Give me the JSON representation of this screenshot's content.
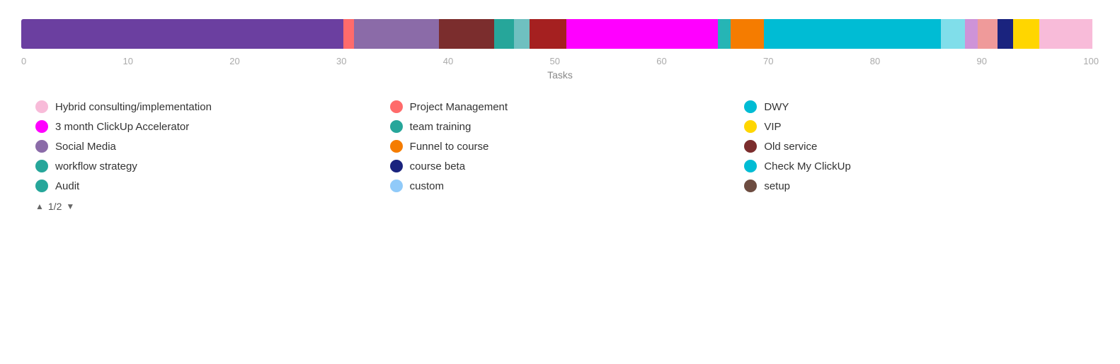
{
  "chart": {
    "axis_label": "Tasks",
    "ticks": [
      "0",
      "10",
      "20",
      "30",
      "40",
      "50",
      "60",
      "70",
      "80",
      "90",
      "100"
    ],
    "segments": [
      {
        "color": "#6B3FA0",
        "width": 24.5
      },
      {
        "color": "#FF6B6B",
        "width": 0.8
      },
      {
        "color": "#8B6BA8",
        "width": 6.5
      },
      {
        "color": "#7B2D2D",
        "width": 4.2
      },
      {
        "color": "#26A69A",
        "width": 1.5
      },
      {
        "color": "#6FC0C0",
        "width": 1.2
      },
      {
        "color": "#A52020",
        "width": 2.8
      },
      {
        "color": "#FF00FF",
        "width": 11.5
      },
      {
        "color": "#26B5B5",
        "width": 1.0
      },
      {
        "color": "#F57C00",
        "width": 2.5
      },
      {
        "color": "#00BCD4",
        "width": 13.5
      },
      {
        "color": "#80DEEA",
        "width": 1.8
      },
      {
        "color": "#CE93D8",
        "width": 1.0
      },
      {
        "color": "#EF9A9A",
        "width": 1.5
      },
      {
        "color": "#1A237E",
        "width": 1.2
      },
      {
        "color": "#FFD600",
        "width": 2.0
      },
      {
        "color": "#F8BBD9",
        "width": 4.0
      },
      {
        "color": "#FFFFFF",
        "width": 0.5
      }
    ]
  },
  "legend": {
    "items": [
      {
        "label": "Hybrid consulting/implementation",
        "color": "#F8BBD9"
      },
      {
        "label": "Project Management",
        "color": "#FF6B6B"
      },
      {
        "label": "DWY",
        "color": "#00BCD4"
      },
      {
        "label": "3 month ClickUp Accelerator",
        "color": "#FF00FF"
      },
      {
        "label": "team training",
        "color": "#26A69A"
      },
      {
        "label": "VIP",
        "color": "#FFD600"
      },
      {
        "label": "Social Media",
        "color": "#8B6BA8"
      },
      {
        "label": "Funnel to course",
        "color": "#F57C00"
      },
      {
        "label": "Old service",
        "color": "#7B2D2D"
      },
      {
        "label": "workflow strategy",
        "color": "#26A69A"
      },
      {
        "label": "course beta",
        "color": "#1A237E"
      },
      {
        "label": "Check My ClickUp",
        "color": "#00BCD4"
      },
      {
        "label": "Audit",
        "color": "#26A69A"
      },
      {
        "label": "custom",
        "color": "#90CAF9"
      },
      {
        "label": "setup",
        "color": "#6D4C41"
      }
    ]
  },
  "pagination": {
    "current": "1/2",
    "up_icon": "▲",
    "down_icon": "▼"
  }
}
